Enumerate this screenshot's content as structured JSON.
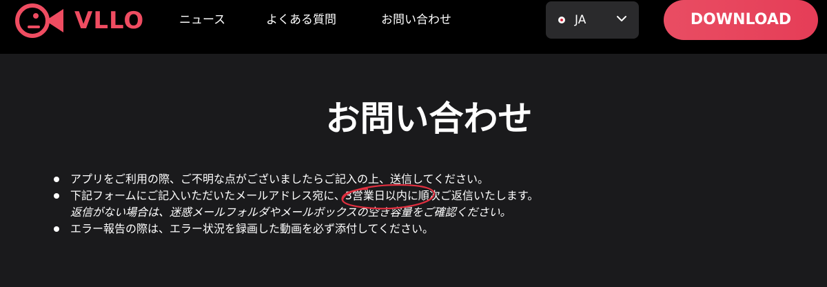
{
  "header": {
    "logo_text": "VLLO",
    "nav": {
      "news": "ニュース",
      "faq": "よくある質問",
      "contact": "お問い合わせ"
    },
    "language": {
      "selected": "JA"
    },
    "download_label": "DOWNLOAD"
  },
  "main": {
    "title": "お問い合わせ",
    "items": [
      {
        "text": "アプリをご利用の際、ご不明な点がございましたらご記入の上、送信してください。"
      },
      {
        "text_before": "下記フォームにご記入いただいたメールアドレス宛に、",
        "text_highlight": "3営業日以内",
        "text_after": "に順次ご返信いたします。",
        "sub_text": "返信がない場合は、迷惑メールフォルダやメールボックスの空き容量をご確認ください。"
      },
      {
        "text": "エラー報告の際は、エラー状況を録画した動画を必ず添付してください。"
      }
    ]
  },
  "colors": {
    "brand": "#ef4c61",
    "header_bg": "#000000",
    "page_bg": "#1a1a1c",
    "annotation": "#e03040"
  },
  "icons": {
    "logo": "fish-logo-icon",
    "language_flag": "japan-flag-icon",
    "dropdown": "chevron-down-icon"
  }
}
